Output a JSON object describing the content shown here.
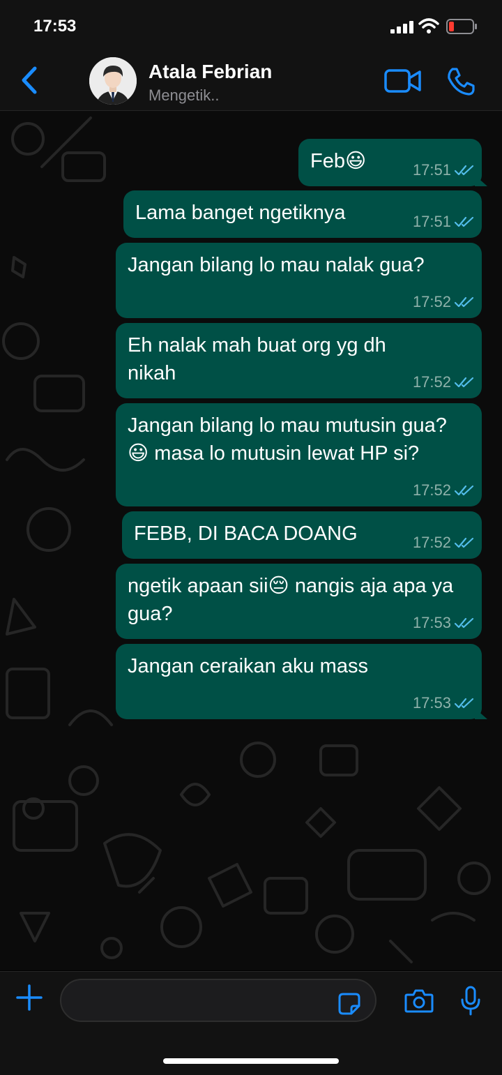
{
  "status_bar": {
    "time": "17:53"
  },
  "header": {
    "contact_name": "Atala Febrian",
    "contact_status": "Mengetik.."
  },
  "colors": {
    "accent": "#1a8cff",
    "bubble_outgoing": "#005046",
    "read_ticks": "#53bdeb"
  },
  "messages": [
    {
      "text": "Feb😃",
      "time": "17:51",
      "status": "read"
    },
    {
      "text": "Lama banget ngetiknya",
      "time": "17:51",
      "status": "read"
    },
    {
      "text": "Jangan bilang lo mau nalak gua?",
      "time": "17:52",
      "status": "read"
    },
    {
      "text": "Eh nalak mah buat org yg dh nikah",
      "time": "17:52",
      "status": "read"
    },
    {
      "text": "Jangan bilang lo mau mutusin gua? 😃 masa lo mutusin lewat HP si?",
      "time": "17:52",
      "status": "read"
    },
    {
      "text": "FEBB, DI BACA DOANG",
      "time": "17:52",
      "status": "read"
    },
    {
      "text": "ngetik apaan sii😔 nangis aja apa ya gua?",
      "time": "17:53",
      "status": "read"
    },
    {
      "text": "Jangan ceraikan aku mass",
      "time": "17:53",
      "status": "read"
    }
  ],
  "icons": {
    "back": "chevron-left-icon",
    "video": "video-camera-icon",
    "call": "phone-icon",
    "attach": "plus-icon",
    "sticker": "sticker-icon",
    "camera": "camera-icon",
    "mic": "microphone-icon"
  }
}
